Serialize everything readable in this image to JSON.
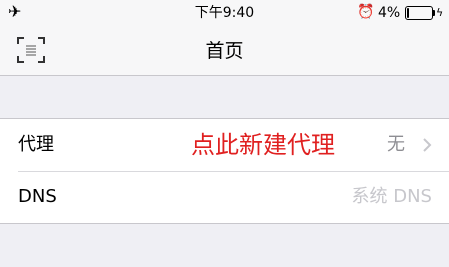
{
  "status_bar": {
    "airplane_icon": "✈",
    "time": "下午9:40",
    "alarm_icon": "⏰",
    "battery_percent": "4%",
    "battery_level": 0.04,
    "charging_icon": "ϟ"
  },
  "nav": {
    "title": "首页",
    "scan_icon": "scan-icon"
  },
  "rows": [
    {
      "label": "代理",
      "value": "无",
      "annotation": "点此新建代理"
    },
    {
      "label": "DNS",
      "value": "系统 DNS"
    }
  ]
}
